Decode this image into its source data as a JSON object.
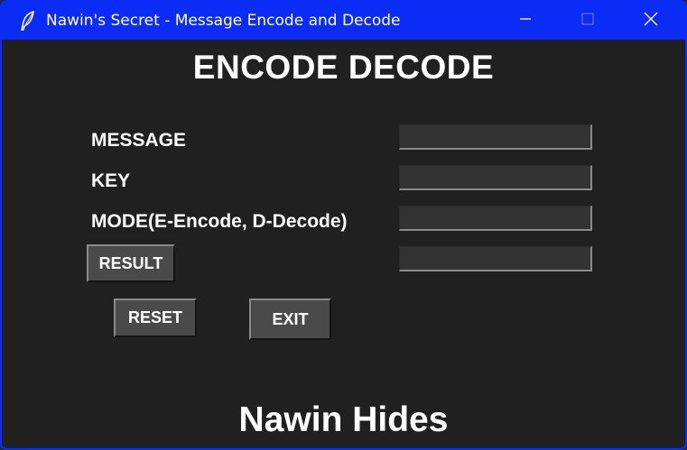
{
  "window": {
    "title": "Nawin's Secret - Message Encode and Decode",
    "accent_color": "#0a2cf5",
    "background_color": "#202020",
    "icons": [
      "feather-icon",
      "minimize-icon",
      "maximize-icon",
      "close-icon"
    ]
  },
  "main": {
    "heading": "ENCODE DECODE",
    "fields": [
      {
        "label": "MESSAGE",
        "value": ""
      },
      {
        "label": "KEY",
        "value": ""
      },
      {
        "label": "MODE(E-Encode, D-Decode)",
        "value": ""
      },
      {
        "value": ""
      }
    ],
    "buttons": {
      "result": "RESULT",
      "reset": "RESET",
      "exit": "EXIT"
    },
    "footer": "Nawin Hides"
  }
}
